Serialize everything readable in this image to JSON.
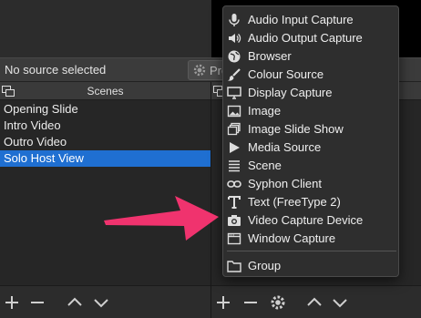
{
  "status": {
    "text": "No source selected",
    "properties_label": "Pro"
  },
  "scenes": {
    "title": "Scenes",
    "items": [
      "Opening Slide",
      "Intro Video",
      "Outro Video",
      "Solo Host View"
    ],
    "selected_index": 3
  },
  "menu": {
    "items": [
      {
        "label": "Audio Input Capture",
        "icon": "microphone-icon"
      },
      {
        "label": "Audio Output Capture",
        "icon": "speaker-icon"
      },
      {
        "label": "Browser",
        "icon": "globe-icon"
      },
      {
        "label": "Colour Source",
        "icon": "brush-icon"
      },
      {
        "label": "Display Capture",
        "icon": "monitor-icon"
      },
      {
        "label": "Image",
        "icon": "image-icon"
      },
      {
        "label": "Image Slide Show",
        "icon": "slideshow-icon"
      },
      {
        "label": "Media Source",
        "icon": "play-icon"
      },
      {
        "label": "Scene",
        "icon": "list-icon"
      },
      {
        "label": "Syphon Client",
        "icon": "link-icon"
      },
      {
        "label": "Text (FreeType 2)",
        "icon": "text-icon"
      },
      {
        "label": "Video Capture Device",
        "icon": "camera-icon"
      },
      {
        "label": "Window Capture",
        "icon": "window-icon"
      }
    ],
    "group_label": "Group"
  },
  "colors": {
    "selection": "#1f6fd1",
    "arrow": "#f0336e"
  }
}
